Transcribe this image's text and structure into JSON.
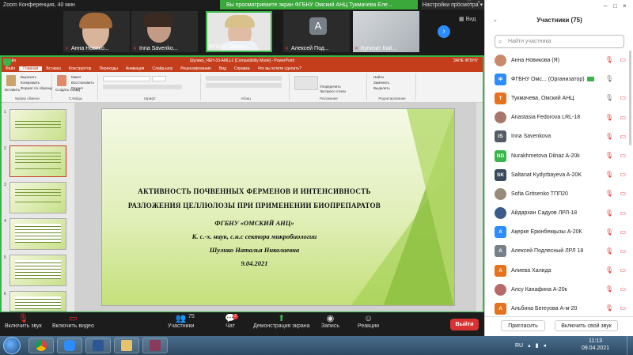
{
  "zoom": {
    "window_title": "Zoom Конференция, 40 мин",
    "share_banner": "Вы просматриваете экран ФГБНУ Омский АНЦ Тукмачева Еле...",
    "view_options": "Настройки просмотра",
    "view_label": "Вид"
  },
  "video_tiles": [
    {
      "name": "Анна Новико..."
    },
    {
      "name": "Inna Savenko..."
    },
    {
      "name": "ФГБНУ Омски..."
    },
    {
      "name": "Алексей Под...",
      "initial": "А"
    },
    {
      "name": "Кулизат Кай..."
    }
  ],
  "ppt": {
    "title": "Шулико_ЧЕН-33-АМЦ-2 [Compatibility Mode] - PowerPoint",
    "left_title": "Файл",
    "right_title": "ЗАНЕ ФГБНУ",
    "tabs": [
      "Файл",
      "Главная",
      "Вставка",
      "Конструктор",
      "Переходы",
      "Анимация",
      "Слайд-шоу",
      "Рецензирование",
      "Вид",
      "Справка",
      "Что вы хотите сделать?"
    ],
    "ribbon_groups": [
      "Буфер обмена",
      "Слайды",
      "Шрифт",
      "Абзац",
      "Рисование",
      "Редактирование"
    ],
    "ribbon_items": {
      "paste": "Вставить",
      "cut": "Вырезать",
      "copy": "Копировать",
      "format": "Формат по образцу",
      "new_slide": "Создать слайд",
      "layout": "Макет",
      "reset": "Восстановить",
      "section": "Раздел",
      "arrange": "Упорядочить",
      "quick_styles": "Экспресс-стили",
      "find": "Найти",
      "replace": "Заменить",
      "select": "Выделить"
    }
  },
  "slide": {
    "line1": "АКТИВНОСТЬ ПОЧВЕННЫХ ФЕРМЕНОВ И ИНТЕНСИВНОСТЬ",
    "line2": "РАЗЛОЖЕНИЯ ЦЕЛЛЮЛОЗЫ ПРИ ПРИМЕНЕНИИ БИОПРЕПАРАТОВ",
    "line3": "ФГБНУ «ОМСКИЙ АНЦ»",
    "line4": "К. с.-х. наук, с.н.с сектора микробиологии",
    "line5": "Шулико Наталья Николаевна",
    "line6": "9.04.2021"
  },
  "thumb_numbers": [
    "1",
    "2",
    "3",
    "4",
    "5",
    "6"
  ],
  "bottom_bar": {
    "unmute": "Включить звук",
    "video": "Включить видео",
    "participants": "Участники",
    "participants_count": "75",
    "chat": "Чат",
    "chat_badge": "2",
    "share": "Демонстрация экрана",
    "record": "Запись",
    "reactions": "Реакции",
    "leave": "Выйти"
  },
  "panel": {
    "title": "Участники (75)",
    "search_placeholder": "Найти участника",
    "invite": "Пригласить",
    "unmute_me": "Включить свой звук",
    "participants": [
      {
        "name": "Анна Новикова (Я)",
        "avatar": "photo",
        "color": "#c98a6a"
      },
      {
        "name": "ФГБНУ Омс... (Организатор)",
        "avatar": "Ф",
        "color": "#2d8cff",
        "host": true
      },
      {
        "name": "Тукмачева, Омский АНЦ",
        "avatar": "Т",
        "color": "#e8721c"
      },
      {
        "name": "Anastasia Fedorova LRL-18",
        "avatar": "photo",
        "color": "#a8766a"
      },
      {
        "name": "Inna Savenkova",
        "avatar": "IS",
        "color": "#555b66"
      },
      {
        "name": "Nurakhmetova Dilnaz A-20k",
        "avatar": "ND",
        "color": "#3ab54a"
      },
      {
        "name": "Saltanat Kydyrbayeva A-20K",
        "avatar": "SK",
        "color": "#3a4a5c"
      },
      {
        "name": "Sofia Gritsenko ТПП20",
        "avatar": "photo",
        "color": "#9a8a7a"
      },
      {
        "name": "Айдархан Садуов ЛРЛ-18",
        "avatar": "photo",
        "color": "#3a5a8a"
      },
      {
        "name": "Ақерке Еркінбекқызы А-20К",
        "avatar": "А",
        "color": "#2d8cff"
      },
      {
        "name": "Алексей Подлесный ЛРЛ 18",
        "avatar": "А",
        "color": "#777f88"
      },
      {
        "name": "Алиева Халида",
        "avatar": "А",
        "color": "#e8721c"
      },
      {
        "name": "Алсу Канафина А-20к",
        "avatar": "photo",
        "color": "#b86a6a"
      },
      {
        "name": "Альбина Бегеуова А-м-20",
        "avatar": "А",
        "color": "#e8721c"
      }
    ]
  },
  "taskbar": {
    "lang": "RU",
    "time": "11:13",
    "date": "09.04.2021"
  },
  "colors": {
    "zoom_green": "#3ab54a",
    "ppt_red": "#c43e1c",
    "leave_red": "#d83232",
    "zoom_blue": "#2d8cff"
  }
}
